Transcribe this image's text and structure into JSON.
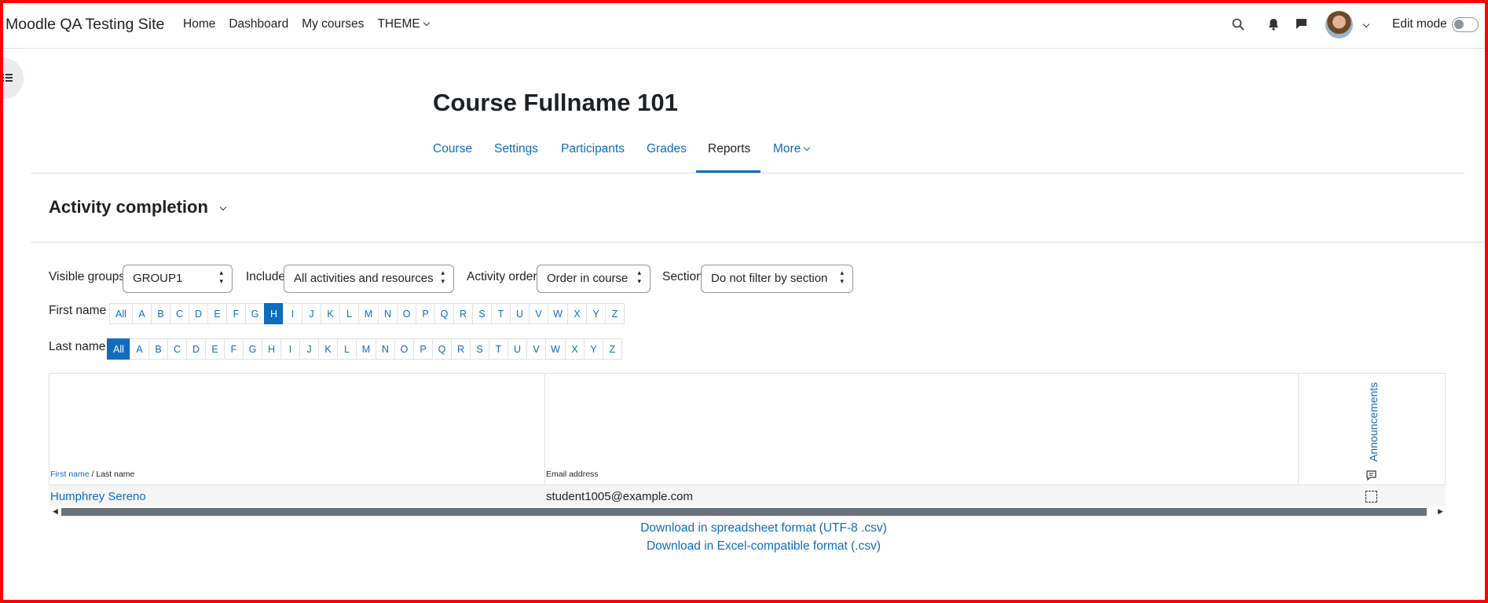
{
  "navbar": {
    "site_name": "Moodle QA Testing Site",
    "links": [
      "Home",
      "Dashboard",
      "My courses",
      "THEME"
    ],
    "edit_mode_label": "Edit mode"
  },
  "course": {
    "title": "Course Fullname 101",
    "tabs": [
      "Course",
      "Settings",
      "Participants",
      "Grades",
      "Reports",
      "More"
    ],
    "active_tab": "Reports"
  },
  "report": {
    "heading": "Activity completion",
    "filters": {
      "visible_groups_label": "Visible groups",
      "visible_groups_value": "GROUP1",
      "include_label": "Include",
      "include_value": "All activities and resources",
      "activity_order_label": "Activity order",
      "activity_order_value": "Order in course",
      "section_label": "Section",
      "section_value": "Do not filter by section"
    },
    "initials": {
      "first_name_label": "First name",
      "first_name_selected": "H",
      "last_name_label": "Last name",
      "last_name_selected": "All",
      "letters": [
        "All",
        "A",
        "B",
        "C",
        "D",
        "E",
        "F",
        "G",
        "H",
        "I",
        "J",
        "K",
        "L",
        "M",
        "N",
        "O",
        "P",
        "Q",
        "R",
        "S",
        "T",
        "U",
        "V",
        "W",
        "X",
        "Y",
        "Z"
      ]
    },
    "table": {
      "col_first_name": "First name",
      "col_name_sep": " / ",
      "col_last_name": "Last name",
      "col_email": "Email address",
      "activity": "Announcements",
      "rows": [
        {
          "name": "Humphrey Sereno",
          "email": "student1005@example.com"
        }
      ]
    },
    "downloads": [
      "Download in spreadsheet format (UTF-8 .csv)",
      "Download in Excel-compatible format (.csv)"
    ]
  }
}
